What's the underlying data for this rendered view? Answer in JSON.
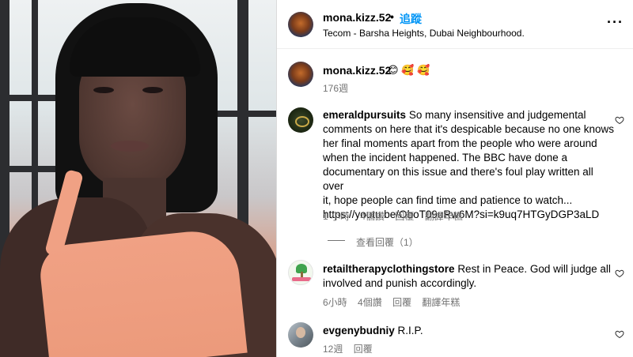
{
  "post": {
    "author": "mona.kizz.52",
    "follow_label": "追蹤",
    "location": "Tecom - Barsha Heights, Dubai Neighbourhood.",
    "more_icon": "more-horizontal-icon"
  },
  "caption": {
    "author": "mona.kizz.52",
    "emojis": "😊 🥰 🥰",
    "time": "176週"
  },
  "comments": [
    {
      "author": "emeraldpursuits",
      "text_lines": [
        "So many insensitive and judgemental",
        "comments on here that it's despicable because no one knows",
        "her final moments apart from the people who were around",
        "when the incident happened. The BBC have done a",
        "documentary on this issue and there's foul play written all over",
        "it, hope people can find time and patience to watch...",
        "https://youtu.be/OboT09uRw6M?si=k9uq7HTGyDGP3aLD"
      ],
      "time": "1 小時",
      "likes": "4個讚",
      "reply": "回覆",
      "translate": "翻譯年糕",
      "view_replies": "查看回覆（1）"
    },
    {
      "author": "retailtherapyclothingstore",
      "text_lines": [
        "Rest in Peace. God will judge all",
        "involved and punish accordingly."
      ],
      "time": "6小時",
      "likes": "4個讚",
      "reply": "回覆",
      "translate": "翻譯年糕"
    },
    {
      "author": "evgenybudniy",
      "text_lines": [
        "R.I.P."
      ],
      "time": "12週",
      "reply": "回覆"
    }
  ],
  "colors": {
    "link": "#0095f6",
    "meta": "#737373",
    "border": "#dbdbdb"
  }
}
